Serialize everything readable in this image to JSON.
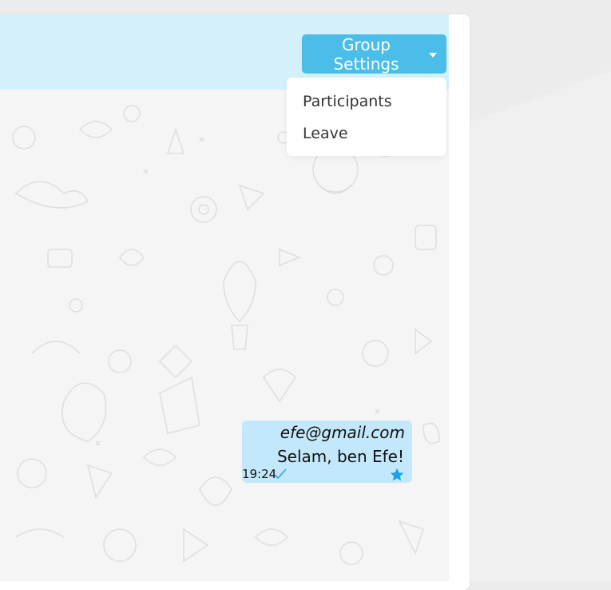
{
  "header": {
    "group_settings_label": "Group Settings",
    "menu": [
      {
        "label": "Participants"
      },
      {
        "label": "Leave"
      }
    ]
  },
  "messages": [
    {
      "sender": "efe@gmail.com",
      "text": "Selam, ben Efe!",
      "time": "19:24",
      "status_icon": "check-icon",
      "starred": true
    }
  ],
  "colors": {
    "header_bg": "#d4f1fb",
    "button_bg": "#4bbde9",
    "message_bg": "#c4e8fb",
    "star": "#1aa3e8",
    "check": "#2fa4e7"
  }
}
